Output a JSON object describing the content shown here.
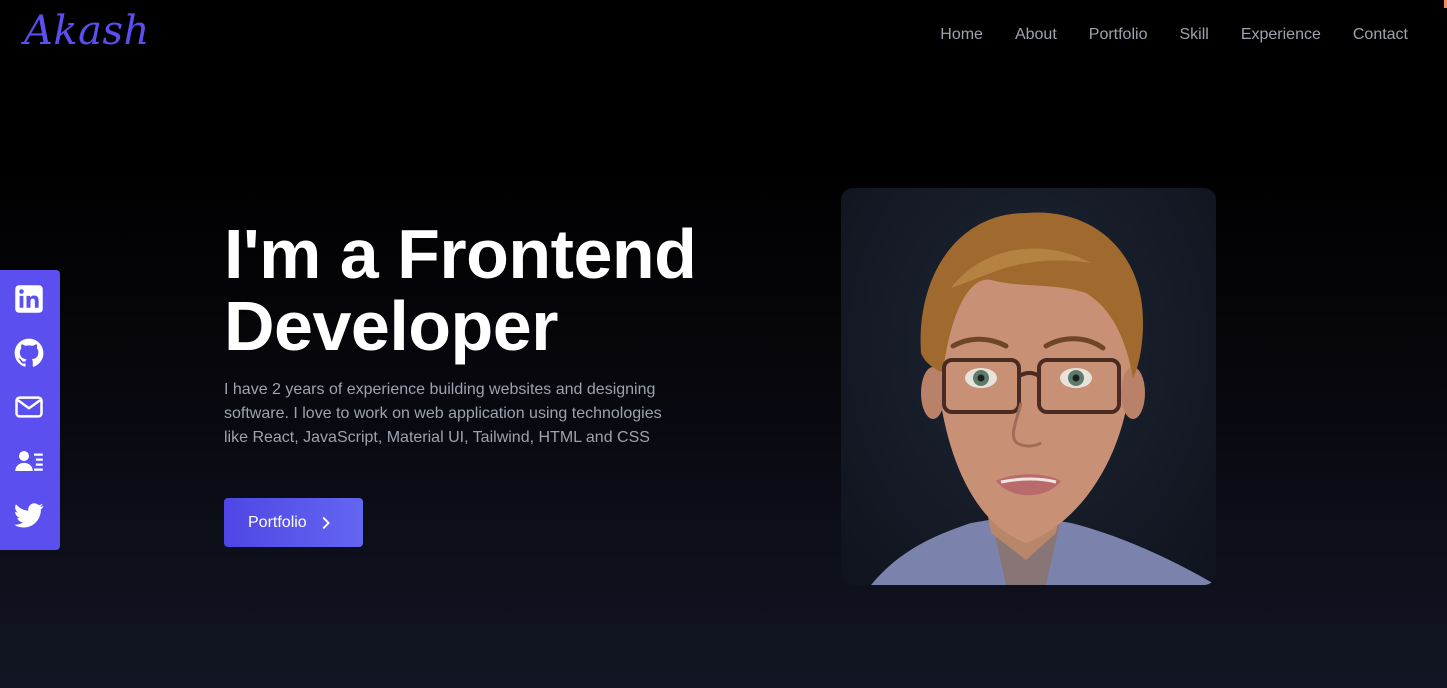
{
  "brand": {
    "logo_text": "Akash",
    "accent_color": "#5b4ff0"
  },
  "nav": {
    "items": [
      {
        "label": "Home"
      },
      {
        "label": "About"
      },
      {
        "label": "Portfolio"
      },
      {
        "label": "Skill"
      },
      {
        "label": "Experience"
      },
      {
        "label": "Contact"
      }
    ]
  },
  "social": {
    "items": [
      {
        "icon": "linkedin-icon"
      },
      {
        "icon": "github-icon"
      },
      {
        "icon": "mail-icon"
      },
      {
        "icon": "resume-icon"
      },
      {
        "icon": "twitter-icon"
      }
    ]
  },
  "hero": {
    "title_line1": "I'm a Frontend",
    "title_line2": "Developer",
    "description": "I have 2 years of experience building websites and designing software. I love to work on web application using technologies like React, JavaScript, Material UI, Tailwind, HTML and CSS",
    "button_label": "Portfolio",
    "button_color": "#5b50ef"
  }
}
